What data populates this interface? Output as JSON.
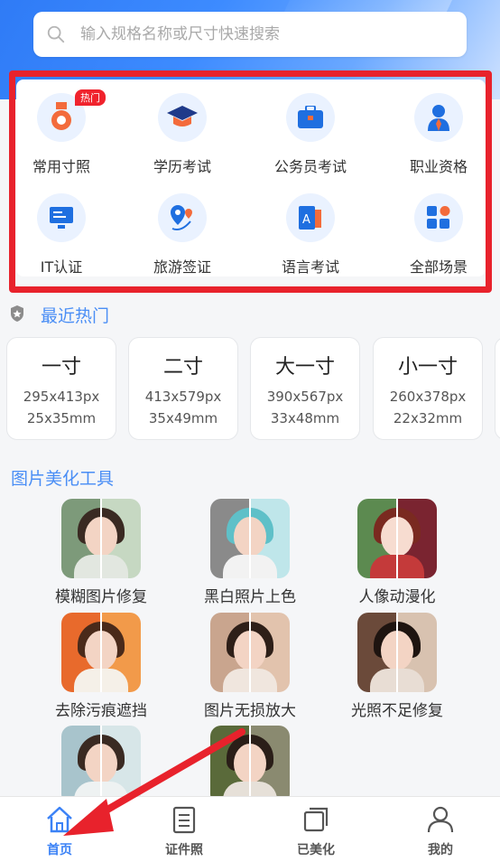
{
  "search": {
    "placeholder": "输入规格名称或尺寸快速搜索"
  },
  "categories": [
    {
      "label": "常用寸照",
      "icon": "medal-icon",
      "badge": "热门"
    },
    {
      "label": "学历考试",
      "icon": "graduation-cap-icon"
    },
    {
      "label": "公务员考试",
      "icon": "briefcase-icon"
    },
    {
      "label": "职业资格",
      "icon": "person-tie-icon"
    },
    {
      "label": "IT认证",
      "icon": "monitor-icon"
    },
    {
      "label": "旅游签证",
      "icon": "location-pin-icon"
    },
    {
      "label": "语言考试",
      "icon": "language-book-icon"
    },
    {
      "label": "全部场景",
      "icon": "grid-apps-icon"
    }
  ],
  "recent": {
    "title": "最近热门",
    "cards": [
      {
        "name": "一寸",
        "px": "295x413px",
        "mm": "25x35mm"
      },
      {
        "name": "二寸",
        "px": "413x579px",
        "mm": "35x49mm"
      },
      {
        "name": "大一寸",
        "px": "390x567px",
        "mm": "33x48mm"
      },
      {
        "name": "小一寸",
        "px": "260x378px",
        "mm": "22x32mm"
      }
    ]
  },
  "tools": {
    "title": "图片美化工具",
    "items": [
      {
        "label": "模糊图片修复"
      },
      {
        "label": "黑白照片上色"
      },
      {
        "label": "人像动漫化"
      },
      {
        "label": "去除污痕遮挡"
      },
      {
        "label": "图片无损放大"
      },
      {
        "label": "光照不足修复"
      },
      {
        "label": ""
      },
      {
        "label": ""
      }
    ]
  },
  "tabbar": {
    "tabs": [
      {
        "label": "首页",
        "icon": "home-icon",
        "active": true
      },
      {
        "label": "证件照",
        "icon": "document-list-icon"
      },
      {
        "label": "已美化",
        "icon": "stacked-squares-icon"
      },
      {
        "label": "我的",
        "icon": "user-icon"
      }
    ]
  },
  "colors": {
    "accent": "#3b82f6",
    "highlight": "#e8222c",
    "badge": "#f0232d"
  }
}
